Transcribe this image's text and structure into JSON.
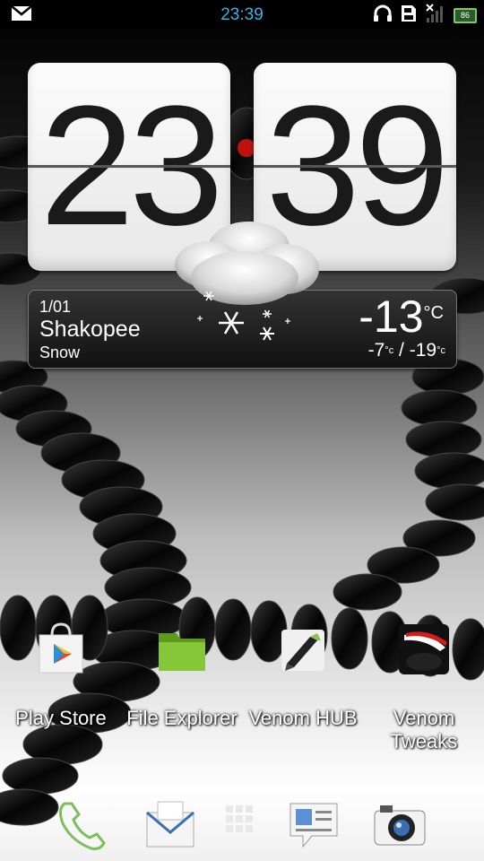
{
  "status_bar": {
    "time": "23:39",
    "battery": "86",
    "icons": [
      "gmail-icon",
      "headphones-icon",
      "sd-card-icon",
      "signal-off-icon",
      "battery-icon"
    ]
  },
  "clock": {
    "hour": "23",
    "minute": "39"
  },
  "weather": {
    "date": "1/01",
    "city": "Shakopee",
    "condition": "Snow",
    "temperature": "-13",
    "unit": "°C",
    "high": "-7",
    "low": "-19",
    "range_unit": "°c",
    "separator": "/",
    "icon": "snow-cloud-icon"
  },
  "apps": [
    {
      "label": "Play Store",
      "icon": "play-store-icon"
    },
    {
      "label": "File Explorer",
      "icon": "folder-icon"
    },
    {
      "label": "Venom HUB",
      "icon": "venom-hub-icon"
    },
    {
      "label": "Venom Tweaks",
      "icon": "venom-tweaks-icon"
    }
  ],
  "dock": [
    {
      "icon": "phone-icon"
    },
    {
      "icon": "mail-icon"
    },
    {
      "icon": "app-drawer-icon"
    },
    {
      "icon": "messages-icon"
    },
    {
      "icon": "camera-icon"
    }
  ]
}
